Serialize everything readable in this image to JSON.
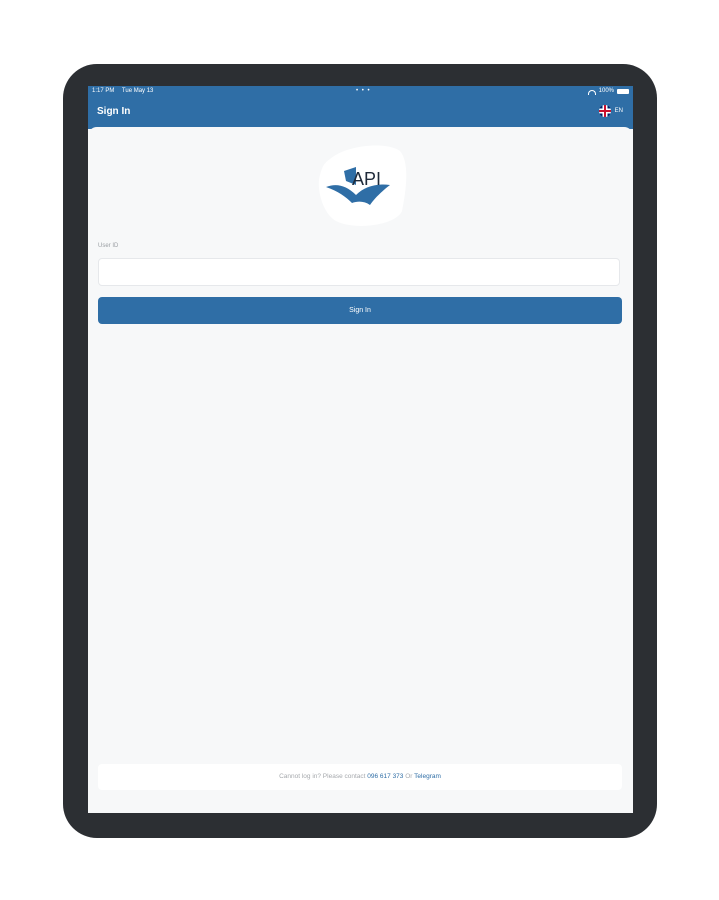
{
  "status_bar": {
    "time": "1:17 PM",
    "date": "Tue May 13",
    "center_dots": "• • •",
    "battery": "100%",
    "wifi_icon": "wifi-icon",
    "battery_icon": "battery-icon"
  },
  "header": {
    "title": "Sign In",
    "language": "EN",
    "flag_icon": "uk-flag-icon"
  },
  "logo": {
    "text": "API",
    "colors": {
      "brand": "#2f6ea6"
    }
  },
  "form": {
    "user_id_label": "User ID",
    "user_id_value": "",
    "sign_in_label": "Sign In"
  },
  "footer": {
    "prefix": "Cannot log in? Please contact",
    "phone": "096 617 373",
    "or": "Or",
    "telegram": "Telegram"
  },
  "colors": {
    "primary": "#2f6ea6",
    "frame": "#2c2f33",
    "background": "#f7f8f9"
  }
}
